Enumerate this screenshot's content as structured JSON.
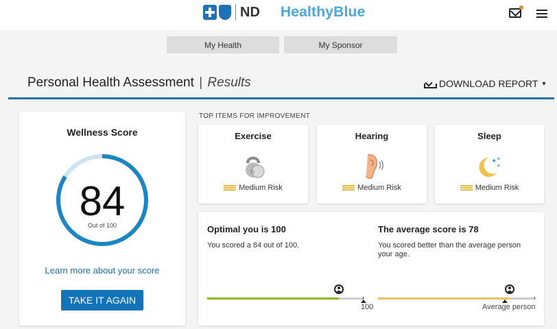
{
  "header": {
    "brand_short": "ND",
    "brand_name": "HealthyBlue"
  },
  "tabs": [
    {
      "label": "My Health"
    },
    {
      "label": "My Sponsor"
    }
  ],
  "page": {
    "title": "Personal Health Assessment",
    "separator": "|",
    "subtitle": "Results",
    "download_label": "DOWNLOAD REPORT",
    "download_caret": "▾"
  },
  "wellness": {
    "title": "Wellness Score",
    "score": "84",
    "out_of": "Out of 100",
    "score_fraction": 0.84,
    "learn_more": "Learn more about your score",
    "take_again": "TAKE IT AGAIN"
  },
  "improvement": {
    "label": "TOP ITEMS FOR IMPROVEMENT",
    "items": [
      {
        "name": "Exercise",
        "risk": "Medium Risk",
        "icon": "kettlebell-icon"
      },
      {
        "name": "Hearing",
        "risk": "Medium Risk",
        "icon": "ear-icon"
      },
      {
        "name": "Sleep",
        "risk": "Medium Risk",
        "icon": "moon-stars-icon"
      }
    ]
  },
  "comparison": {
    "optimal": {
      "heading": "Optimal you is 100",
      "text": "You scored a 84 out of 100.",
      "end_label": "100",
      "progress": 0.84
    },
    "average": {
      "heading": "The average score is 78",
      "text": "You scored better than the average person your age.",
      "end_label": "Average person",
      "progress": 0.84,
      "average_marker": 0.78
    }
  },
  "colors": {
    "accent": "#1373b8",
    "gauge": "#1a86c6",
    "gauge_track": "#cce4f2",
    "green": "#8ab81f",
    "yellow": "#e8c35c"
  }
}
